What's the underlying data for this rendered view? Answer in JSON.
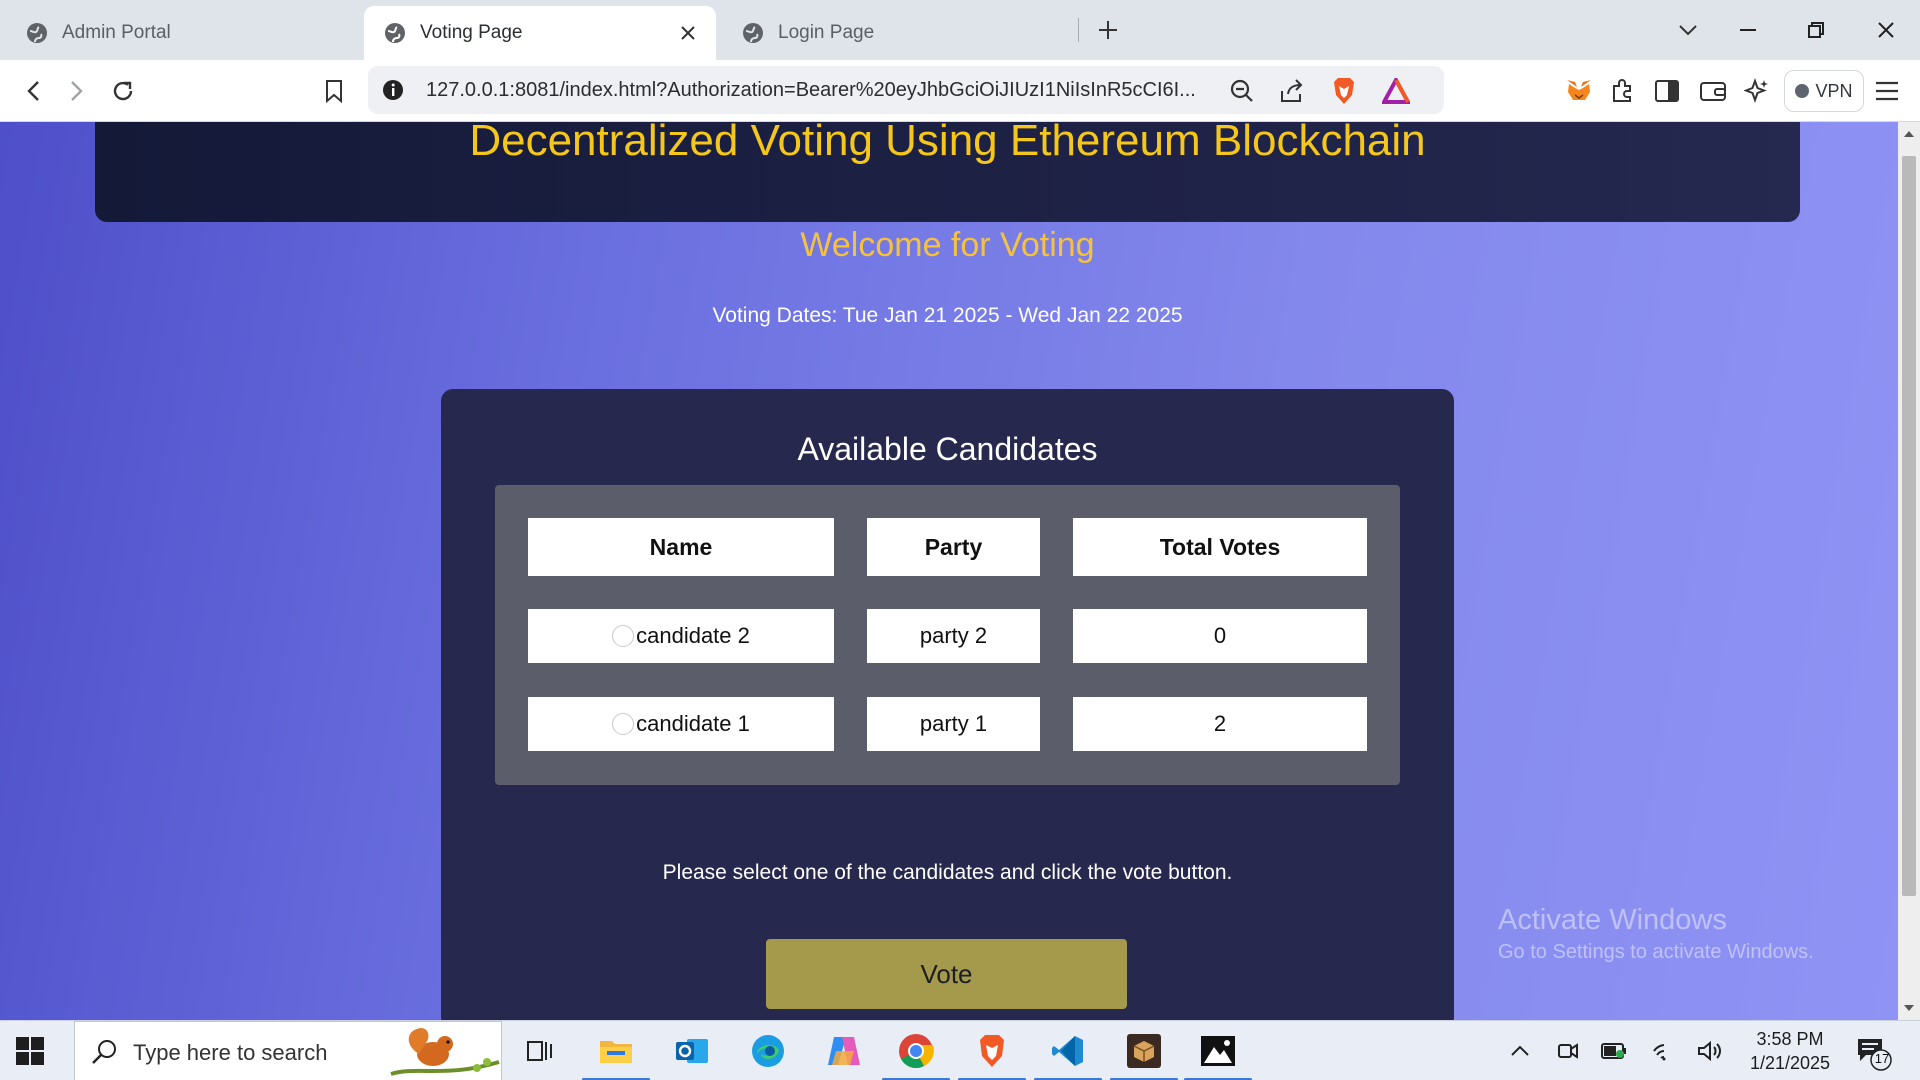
{
  "browser": {
    "tabs": [
      {
        "label": "Admin Portal",
        "active": false
      },
      {
        "label": "Voting Page",
        "active": true
      },
      {
        "label": "Login Page",
        "active": false
      }
    ],
    "url": "127.0.0.1:8081/index.html?Authorization=Bearer%20eyJhbGciOiJIUzI1NiIsInR5cCI6I...",
    "vpn_label": "VPN"
  },
  "page": {
    "site_title": "Decentralized Voting Using Ethereum Blockchain",
    "welcome": "Welcome for Voting",
    "voting_dates": "Voting Dates: Tue Jan 21 2025 - Wed Jan 22 2025",
    "candidates_title": "Available Candidates",
    "table": {
      "headers": [
        "Name",
        "Party",
        "Total Votes"
      ],
      "rows": [
        {
          "name": "candidate 2",
          "party": "party 2",
          "votes": "0"
        },
        {
          "name": "candidate 1",
          "party": "party 1",
          "votes": "2"
        }
      ]
    },
    "instruction": "Please select one of the candidates and click the vote button.",
    "vote_button": "Vote"
  },
  "watermark": {
    "line1": "Activate Windows",
    "line2": "Go to Settings to activate Windows."
  },
  "taskbar": {
    "search_placeholder": "Type here to search",
    "time": "3:58 PM",
    "date": "1/21/2025",
    "notification_count": "17"
  },
  "colors": {
    "title_yellow": "#f5c71a",
    "welcome_yellow": "#f6c23d",
    "card_bg": "#26284d",
    "vote_button": "#a59a4b"
  }
}
